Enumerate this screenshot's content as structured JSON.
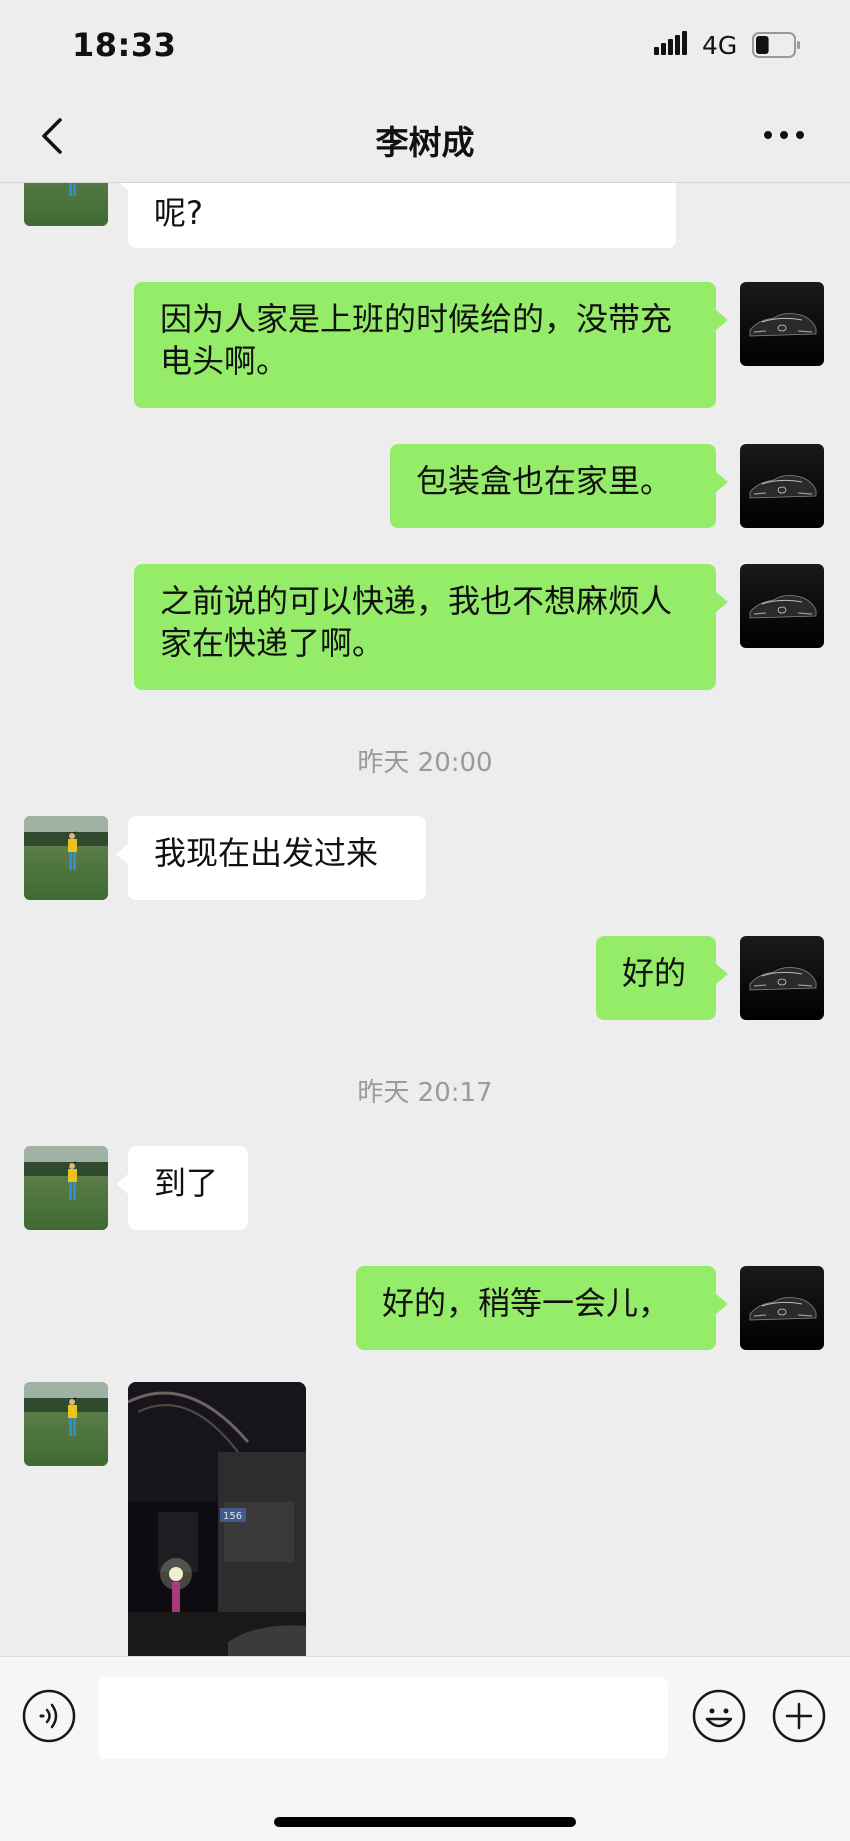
{
  "status_bar": {
    "time": "18:33",
    "network": "4G",
    "battery_level": 0.35
  },
  "header": {
    "title": "李树成"
  },
  "messages": [
    {
      "type": "in_partial",
      "text": "呢?"
    },
    {
      "type": "out",
      "text": "因为人家是上班的时候给的，没带充电头啊。"
    },
    {
      "type": "out",
      "text": "包装盒也在家里。"
    },
    {
      "type": "out",
      "text": "之前说的可以快递，我也不想麻烦人家在快递了啊。"
    },
    {
      "type": "timestamp",
      "text": "昨天 20:00"
    },
    {
      "type": "in",
      "text": "我现在出发过来"
    },
    {
      "type": "out",
      "text": "好的"
    },
    {
      "type": "timestamp",
      "text": "昨天 20:17"
    },
    {
      "type": "in",
      "text": "到了"
    },
    {
      "type": "out",
      "text": "好的，稍等一会儿，"
    },
    {
      "type": "in_image",
      "image_text": "156"
    }
  ],
  "input": {
    "value": "",
    "placeholder": ""
  },
  "icons": {
    "back": "chevron-left-icon",
    "more": "more-dots-icon",
    "voice": "voice-icon",
    "emoji": "emoji-icon",
    "plus": "plus-icon"
  },
  "colors": {
    "outgoing_bubble": "#95ec69",
    "incoming_bubble": "#ffffff",
    "background": "#ededed"
  }
}
